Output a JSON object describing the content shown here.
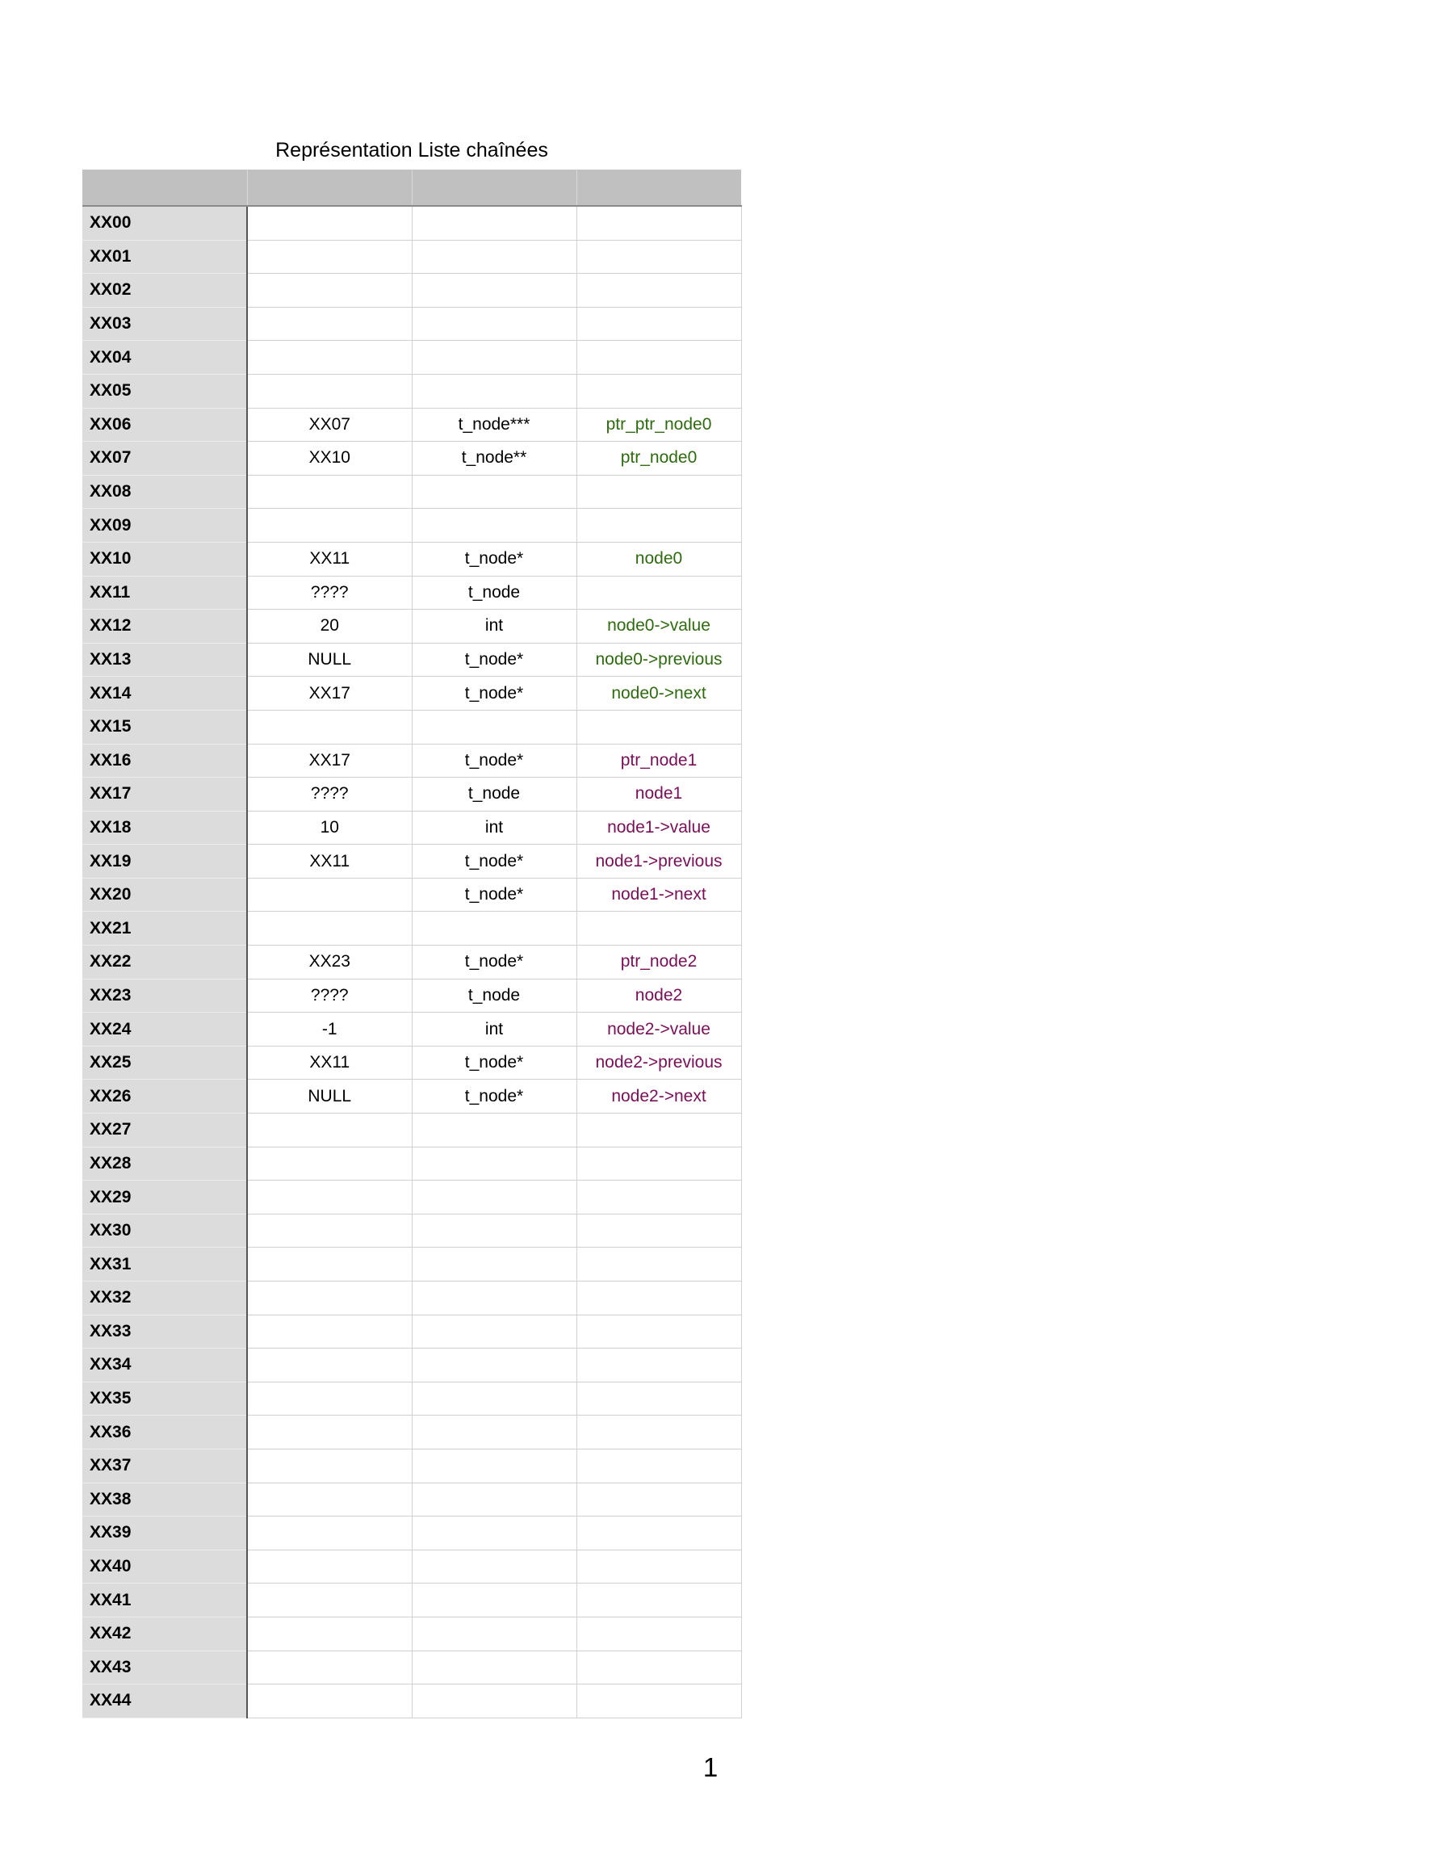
{
  "title": "Représentation Liste chaînées",
  "page_number": "1",
  "colors": {
    "green": "#2e6b0f",
    "purple": "#7a0f57"
  },
  "rows": [
    {
      "addr": "XX00",
      "value": "",
      "type": "",
      "name": "",
      "color": ""
    },
    {
      "addr": "XX01",
      "value": "",
      "type": "",
      "name": "",
      "color": ""
    },
    {
      "addr": "XX02",
      "value": "",
      "type": "",
      "name": "",
      "color": ""
    },
    {
      "addr": "XX03",
      "value": "",
      "type": "",
      "name": "",
      "color": ""
    },
    {
      "addr": "XX04",
      "value": "",
      "type": "",
      "name": "",
      "color": ""
    },
    {
      "addr": "XX05",
      "value": "",
      "type": "",
      "name": "",
      "color": ""
    },
    {
      "addr": "XX06",
      "value": "XX07",
      "type": "t_node***",
      "name": "ptr_ptr_node0",
      "color": "green"
    },
    {
      "addr": "XX07",
      "value": "XX10",
      "type": "t_node**",
      "name": "ptr_node0",
      "color": "green"
    },
    {
      "addr": "XX08",
      "value": "",
      "type": "",
      "name": "",
      "color": ""
    },
    {
      "addr": "XX09",
      "value": "",
      "type": "",
      "name": "",
      "color": ""
    },
    {
      "addr": "XX10",
      "value": "XX11",
      "type": "t_node*",
      "name": "node0",
      "color": "green"
    },
    {
      "addr": "XX11",
      "value": "????",
      "type": "t_node",
      "name": "",
      "color": ""
    },
    {
      "addr": "XX12",
      "value": "20",
      "type": "int",
      "name": "node0->value",
      "color": "green"
    },
    {
      "addr": "XX13",
      "value": "NULL",
      "type": "t_node*",
      "name": "node0->previous",
      "color": "green"
    },
    {
      "addr": "XX14",
      "value": "XX17",
      "type": "t_node*",
      "name": "node0->next",
      "color": "green"
    },
    {
      "addr": "XX15",
      "value": "",
      "type": "",
      "name": "",
      "color": ""
    },
    {
      "addr": "XX16",
      "value": "XX17",
      "type": "t_node*",
      "name": "ptr_node1",
      "color": "purple"
    },
    {
      "addr": "XX17",
      "value": "????",
      "type": "t_node",
      "name": "node1",
      "color": "purple"
    },
    {
      "addr": "XX18",
      "value": "10",
      "type": "int",
      "name": "node1->value",
      "color": "purple"
    },
    {
      "addr": "XX19",
      "value": "XX11",
      "type": "t_node*",
      "name": "node1->previous",
      "color": "purple"
    },
    {
      "addr": "XX20",
      "value": "",
      "type": "t_node*",
      "name": "node1->next",
      "color": "purple"
    },
    {
      "addr": "XX21",
      "value": "",
      "type": "",
      "name": "",
      "color": ""
    },
    {
      "addr": "XX22",
      "value": "XX23",
      "type": "t_node*",
      "name": "ptr_node2",
      "color": "purple"
    },
    {
      "addr": "XX23",
      "value": "????",
      "type": "t_node",
      "name": "node2",
      "color": "purple"
    },
    {
      "addr": "XX24",
      "value": "-1",
      "type": "int",
      "name": "node2->value",
      "color": "purple"
    },
    {
      "addr": "XX25",
      "value": "XX11",
      "type": "t_node*",
      "name": "node2->previous",
      "color": "purple"
    },
    {
      "addr": "XX26",
      "value": "NULL",
      "type": "t_node*",
      "name": "node2->next",
      "color": "purple"
    },
    {
      "addr": "XX27",
      "value": "",
      "type": "",
      "name": "",
      "color": ""
    },
    {
      "addr": "XX28",
      "value": "",
      "type": "",
      "name": "",
      "color": ""
    },
    {
      "addr": "XX29",
      "value": "",
      "type": "",
      "name": "",
      "color": ""
    },
    {
      "addr": "XX30",
      "value": "",
      "type": "",
      "name": "",
      "color": ""
    },
    {
      "addr": "XX31",
      "value": "",
      "type": "",
      "name": "",
      "color": ""
    },
    {
      "addr": "XX32",
      "value": "",
      "type": "",
      "name": "",
      "color": ""
    },
    {
      "addr": "XX33",
      "value": "",
      "type": "",
      "name": "",
      "color": ""
    },
    {
      "addr": "XX34",
      "value": "",
      "type": "",
      "name": "",
      "color": ""
    },
    {
      "addr": "XX35",
      "value": "",
      "type": "",
      "name": "",
      "color": ""
    },
    {
      "addr": "XX36",
      "value": "",
      "type": "",
      "name": "",
      "color": ""
    },
    {
      "addr": "XX37",
      "value": "",
      "type": "",
      "name": "",
      "color": ""
    },
    {
      "addr": "XX38",
      "value": "",
      "type": "",
      "name": "",
      "color": ""
    },
    {
      "addr": "XX39",
      "value": "",
      "type": "",
      "name": "",
      "color": ""
    },
    {
      "addr": "XX40",
      "value": "",
      "type": "",
      "name": "",
      "color": ""
    },
    {
      "addr": "XX41",
      "value": "",
      "type": "",
      "name": "",
      "color": ""
    },
    {
      "addr": "XX42",
      "value": "",
      "type": "",
      "name": "",
      "color": ""
    },
    {
      "addr": "XX43",
      "value": "",
      "type": "",
      "name": "",
      "color": ""
    },
    {
      "addr": "XX44",
      "value": "",
      "type": "",
      "name": "",
      "color": ""
    }
  ]
}
